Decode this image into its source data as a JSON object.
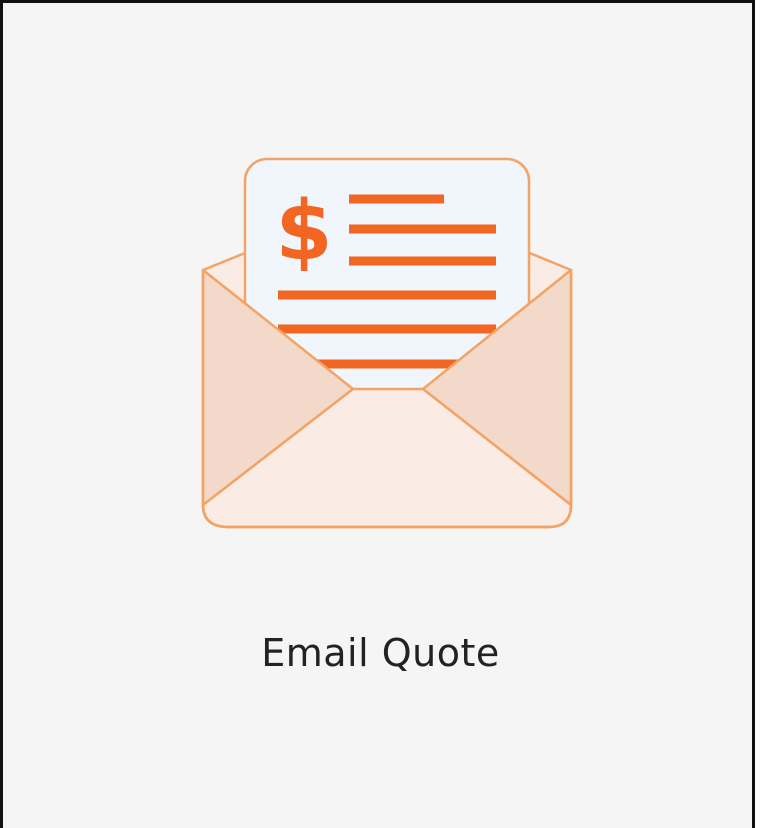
{
  "card": {
    "label": "Email Quote",
    "icon": "email-quote-icon"
  },
  "colors": {
    "background": "#f5f5f5",
    "border": "#111111",
    "accent": "#f26522",
    "envelope_stroke": "#f3a365",
    "envelope_fill_light": "#faebe4",
    "envelope_fill_side": "#f3d9ca",
    "document_fill": "#f0f6fb",
    "label_text": "#222222"
  }
}
